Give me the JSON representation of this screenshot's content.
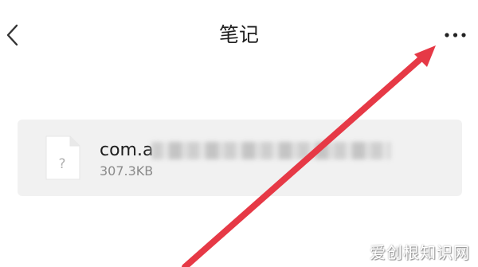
{
  "header": {
    "back_icon": "chevron-left-icon",
    "title": "笔记",
    "more_icon": "more-horizontal-icon"
  },
  "file": {
    "icon": "unknown-file-icon",
    "icon_glyph": "?",
    "name_visible": "com.a",
    "size": "307.3KB"
  },
  "annotation": {
    "type": "red-arrow",
    "color": "#e63946",
    "points_to": "more-button"
  },
  "watermark": {
    "text": "爱创根知识网"
  }
}
